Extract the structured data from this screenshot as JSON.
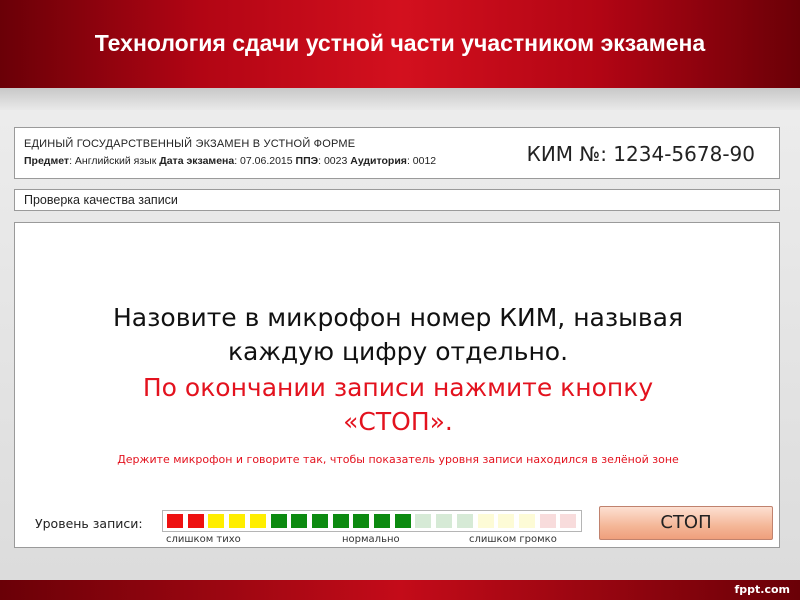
{
  "slide": {
    "title": "Технология сдачи устной части участником экзамена"
  },
  "header": {
    "exam_title": "ЕДИНЫЙ ГОСУДАРСТВЕННЫЙ ЭКЗАМЕН В УСТНОЙ ФОРМЕ",
    "subject_label": "Предмет",
    "subject_value": ": Английский язык ",
    "date_label": "Дата экзамена",
    "date_value": ": 07.06.2015 ",
    "ppe_label": "ППЭ",
    "ppe_value": ": 0023 ",
    "room_label": "Аудитория",
    "room_value": ": 0012",
    "kim": "КИМ №: 1234-5678-90"
  },
  "check": {
    "label": "Проверка качества записи"
  },
  "main": {
    "instruction_line1": "Назовите в микрофон номер КИМ, называя",
    "instruction_line2": "каждую цифру отдельно.",
    "red_line1": "По окончании записи нажмите кнопку",
    "red_line2": "«СТОП».",
    "hint": "Держите микрофон и говорите так, чтобы показатель уровня записи находился в зелёной зоне"
  },
  "meter": {
    "label": "Уровень записи:",
    "too_quiet": "слишком тихо",
    "normal": "нормально",
    "too_loud": "слишком громко",
    "segments": [
      {
        "color": "#ee1111"
      },
      {
        "color": "#ee1111"
      },
      {
        "color": "#ffee00"
      },
      {
        "color": "#ffee00"
      },
      {
        "color": "#ffee00"
      },
      {
        "color": "#0c8a10"
      },
      {
        "color": "#0c8a10"
      },
      {
        "color": "#0c8a10"
      },
      {
        "color": "#0c8a10"
      },
      {
        "color": "#0c8a10"
      },
      {
        "color": "#0c8a10"
      },
      {
        "color": "#0c8a10"
      },
      {
        "color": "#d6ead6"
      },
      {
        "color": "#d6ead6"
      },
      {
        "color": "#d6ead6"
      },
      {
        "color": "#fdfbd6"
      },
      {
        "color": "#fdfbd6"
      },
      {
        "color": "#fdfbd6"
      },
      {
        "color": "#f8dcdc"
      },
      {
        "color": "#f8dcdc"
      }
    ]
  },
  "buttons": {
    "stop": "СТОП"
  },
  "footer": {
    "brand": "fppt.com"
  },
  "colors": {
    "accent_red": "#e3121e",
    "banner_red": "#c40b19",
    "stop_button": "#f4b697"
  }
}
